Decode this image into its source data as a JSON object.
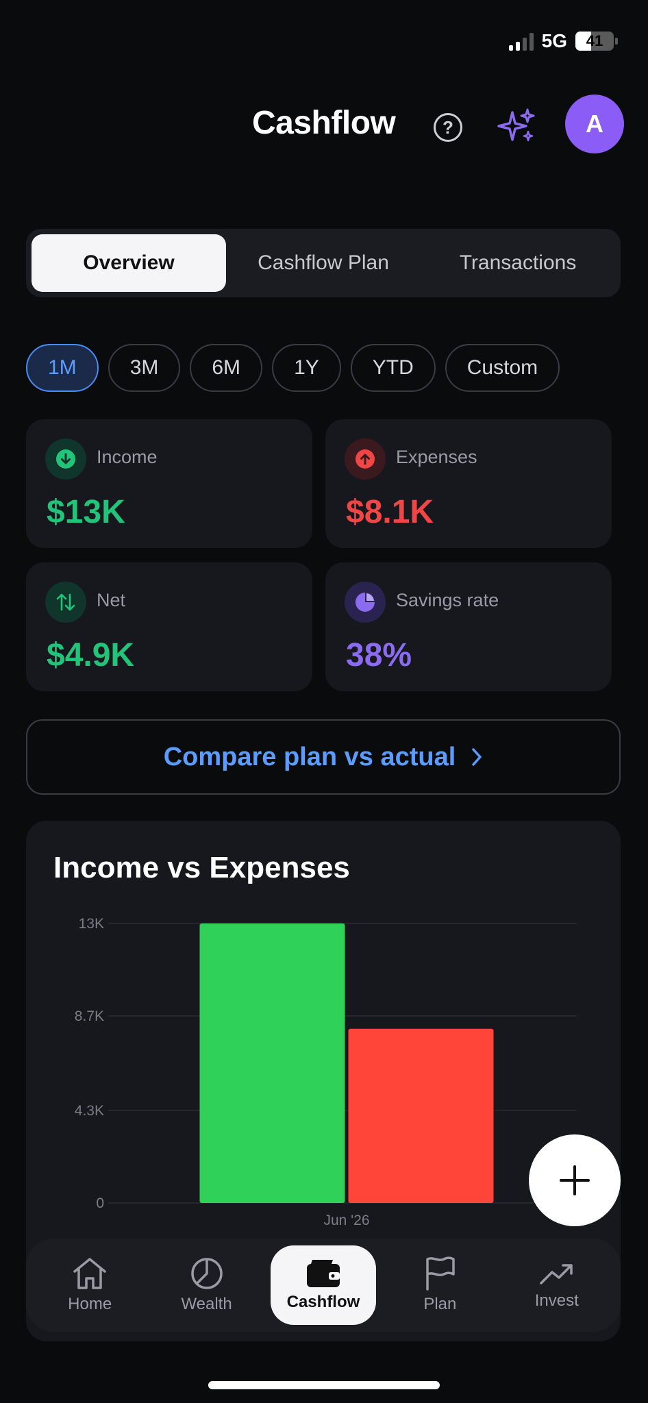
{
  "status_bar": {
    "network": "5G",
    "battery": "41",
    "battery_level": 0.41
  },
  "header": {
    "title": "Cashflow",
    "help_icon": "question-circle-icon",
    "ai_icon": "sparkles-icon",
    "avatar_initial": "A",
    "avatar_color": "#8b5cf6"
  },
  "tabs": [
    {
      "label": "Overview",
      "active": true
    },
    {
      "label": "Cashflow Plan",
      "active": false
    },
    {
      "label": "Transactions",
      "active": false
    }
  ],
  "ranges": [
    {
      "label": "1M",
      "active": true
    },
    {
      "label": "3M",
      "active": false
    },
    {
      "label": "6M",
      "active": false
    },
    {
      "label": "1Y",
      "active": false
    },
    {
      "label": "YTD",
      "active": false
    },
    {
      "label": "Custom",
      "active": false
    }
  ],
  "stats": {
    "income": {
      "label": "Income",
      "value": "$13K",
      "color": "#22c47a"
    },
    "expenses": {
      "label": "Expenses",
      "value": "$8.1K",
      "color": "#f04646"
    },
    "net": {
      "label": "Net",
      "value": "$4.9K",
      "color": "#22c47a"
    },
    "savings": {
      "label": "Savings rate",
      "value": "38%",
      "color": "#8b6cf0"
    }
  },
  "compare_button": {
    "label": "Compare plan vs actual"
  },
  "chart": {
    "title": "Income vs Expenses"
  },
  "chart_data": {
    "type": "bar",
    "categories": [
      "Jun '26"
    ],
    "series": [
      {
        "values": [
          13000
        ],
        "color": "#30d158"
      },
      {
        "values": [
          8100
        ],
        "color": "#ff453a"
      }
    ],
    "ylim": [
      0,
      13000
    ],
    "yticks": [
      0,
      4300,
      8700,
      13000
    ],
    "ytick_labels": [
      "0",
      "4.3K",
      "8.7K",
      "13K"
    ],
    "grid": true
  },
  "fab": {
    "icon": "plus-icon"
  },
  "nav": [
    {
      "label": "Home",
      "icon": "home-icon",
      "active": false
    },
    {
      "label": "Wealth",
      "icon": "pie-chart-icon",
      "active": false
    },
    {
      "label": "Cashflow",
      "icon": "wallet-icon",
      "active": true
    },
    {
      "label": "Plan",
      "icon": "flag-icon",
      "active": false
    },
    {
      "label": "Invest",
      "icon": "trending-up-icon",
      "active": false
    }
  ]
}
